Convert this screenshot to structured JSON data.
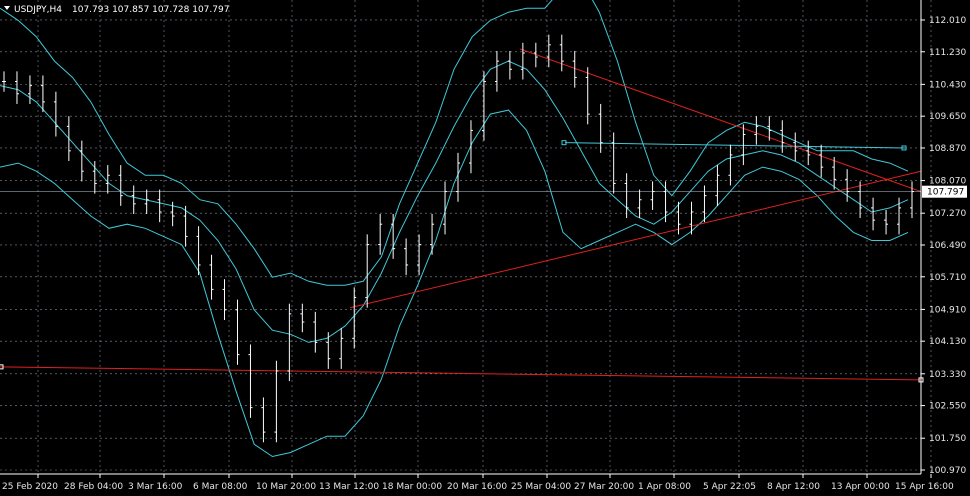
{
  "header": {
    "symbol": "USDJPY,H4",
    "ohlc": "107.793 107.857 107.728 107.797"
  },
  "current_price_label": "107.797",
  "colors": {
    "background": "#000000",
    "grid": "#7f8c99",
    "axis": "#ffffff",
    "candle": "#ffffff",
    "bands": "#40c8d8",
    "price_line": "#8fa4b4",
    "trendline": "#e0201e"
  },
  "chart_data": {
    "type": "line",
    "title": "USDJPY,H4",
    "ylim": [
      100.97,
      112.5
    ],
    "y_ticks": [
      "112.010",
      "111.230",
      "110.430",
      "109.650",
      "108.870",
      "108.070",
      "107.270",
      "106.490",
      "105.710",
      "104.910",
      "104.130",
      "103.330",
      "102.550",
      "101.750",
      "100.970"
    ],
    "x_ticks": [
      "25 Feb 2020",
      "28 Feb 04:00",
      "3 Mar 16:00",
      "6 Mar 08:00",
      "10 Mar 20:00",
      "13 Mar 12:00",
      "18 Mar 00:00",
      "20 Mar 16:00",
      "25 Mar 04:00",
      "27 Mar 20:00",
      "1 Apr 08:00",
      "5 Apr 22:05",
      "8 Apr 12:00",
      "13 Apr 00:00",
      "15 Apr 16:00"
    ],
    "current_price": 107.797,
    "series": [
      {
        "style": "candles",
        "values": [
          110.5,
          110.2,
          110.4,
          110.0,
          109.4,
          108.8,
          108.3,
          108.0,
          108.2,
          107.7,
          107.5,
          107.6,
          107.3,
          107.2,
          106.7,
          106.0,
          105.4,
          104.9,
          103.8,
          102.5,
          101.9,
          103.4,
          104.8,
          104.6,
          104.1,
          103.7,
          104.2,
          105.2,
          106.5,
          107.0,
          106.4,
          106.0,
          106.5,
          107.0,
          107.8,
          108.5,
          109.3,
          110.5,
          111.0,
          110.8,
          111.2,
          111.1,
          111.4,
          111.0,
          110.6,
          109.7,
          109.0,
          108.0,
          107.4,
          107.6,
          107.8,
          107.3,
          107.0,
          107.3,
          107.7,
          108.2,
          108.7,
          109.2,
          109.4,
          109.3,
          109.0,
          108.8,
          108.7,
          108.4,
          108.1,
          107.8,
          107.4,
          107.1,
          107.0,
          107.4,
          107.8
        ]
      },
      {
        "style": "band-upper",
        "values": [
          112.3,
          112.0,
          111.6,
          111.0,
          110.6,
          110.0,
          109.2,
          108.5,
          108.2,
          108.2,
          108.0,
          107.6,
          107.5,
          107.0,
          106.4,
          105.7,
          105.8,
          105.6,
          105.5,
          105.5,
          105.6,
          106.2,
          107.5,
          108.5,
          109.5,
          110.8,
          111.6,
          112.0,
          112.2,
          112.3,
          112.3,
          112.8,
          113.0,
          112.2,
          111.0,
          109.5,
          108.2,
          107.7,
          108.3,
          109.0,
          109.3,
          109.5,
          109.4,
          109.2,
          109.0,
          108.8,
          108.8,
          108.8,
          108.6,
          108.5,
          108.3
        ]
      },
      {
        "style": "band-middle",
        "values": [
          110.4,
          110.3,
          110.0,
          109.5,
          109.0,
          108.5,
          108.0,
          107.7,
          107.6,
          107.5,
          107.4,
          107.1,
          106.6,
          105.9,
          104.9,
          104.4,
          104.3,
          104.1,
          104.2,
          104.5,
          105.0,
          105.8,
          106.8,
          107.7,
          108.5,
          109.4,
          110.2,
          110.8,
          111.0,
          110.8,
          110.3,
          109.6,
          108.8,
          108.0,
          107.6,
          107.2,
          107.0,
          107.3,
          107.8,
          108.3,
          108.6,
          108.7,
          108.8,
          108.7,
          108.5,
          108.2,
          107.9,
          107.6,
          107.3,
          107.4,
          107.6
        ]
      },
      {
        "style": "band-lower",
        "values": [
          108.4,
          108.5,
          108.3,
          108.0,
          107.6,
          107.2,
          106.9,
          107.0,
          106.9,
          106.7,
          106.5,
          105.8,
          104.3,
          102.9,
          101.6,
          101.3,
          101.4,
          101.6,
          101.8,
          101.8,
          102.3,
          103.2,
          104.5,
          105.5,
          106.6,
          108.0,
          109.0,
          109.7,
          109.8,
          109.3,
          108.3,
          106.8,
          106.4,
          106.6,
          106.8,
          107.0,
          106.8,
          106.5,
          106.8,
          107.2,
          107.7,
          108.2,
          108.4,
          108.3,
          108.1,
          107.7,
          107.2,
          106.8,
          106.6,
          106.6,
          106.8
        ]
      },
      {
        "style": "line",
        "name": "horizontal-level",
        "values": [
          108.87
        ]
      }
    ]
  }
}
